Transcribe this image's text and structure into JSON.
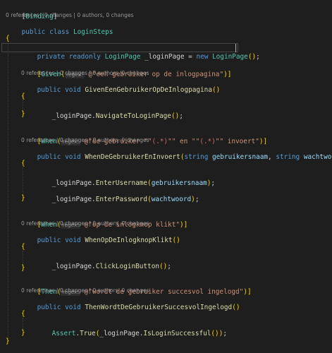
{
  "code": {
    "attr_binding": "Binding",
    "lens_class": "0 references | 0 changes | 0 authors, 0 changes",
    "kw_public": "public",
    "kw_class": "class",
    "class_name": "LoginSteps",
    "kw_private": "private",
    "kw_readonly": "readonly",
    "type_loginpage": "LoginPage",
    "field_name": "_loginPage",
    "kw_new": "new",
    "kw_void": "void",
    "kw_string": "string",
    "hint_regex": "regex:",
    "attr_given": "Given",
    "attr_when": "When",
    "attr_then": "Then",
    "str_given": "@\"een gebruiker op de inlogpagina\"",
    "str_when1_a": "@\"de gebruiker \"\"",
    "str_when1_grp1": "(.*)",
    "str_when1_b": "\"\" en \"\"",
    "str_when1_grp2": "(.*)",
    "str_when1_c": "\"\" invoert\"",
    "str_when2": "@\"op de inlogknop klikt\"",
    "str_then": "@\"wordt de gebruiker succesvol ingelogd\"",
    "lens_method": "0 references | 0 changes | 0 authors, 0 changes",
    "m_given": "GivenEenGebruikerOpDeInlogpagina",
    "m_when1": "WhenDeGebruikerEnInvoert",
    "m_when2": "WhenOpDeInlogknopKlikt",
    "m_then": "ThenWordtDeGebruikerSuccesvolIngelogd",
    "p_user": "gebruikersnaam",
    "p_pass": "wachtwoord",
    "c_navigate": "NavigateToLoginPage",
    "c_enteruser": "EnterUsername",
    "c_enterpass": "EnterPassword",
    "c_click": "ClickLoginButton",
    "t_assert": "Assert",
    "c_true": "True",
    "c_issuccess": "IsLoginSuccessful"
  },
  "colors": {
    "background": "#1e1e1e",
    "keyword": "#569cd6",
    "type": "#4ec9b0",
    "method": "#dcdcaa",
    "parameter": "#9cdcfe",
    "string": "#ce9178",
    "bracket": "#ffd700"
  }
}
